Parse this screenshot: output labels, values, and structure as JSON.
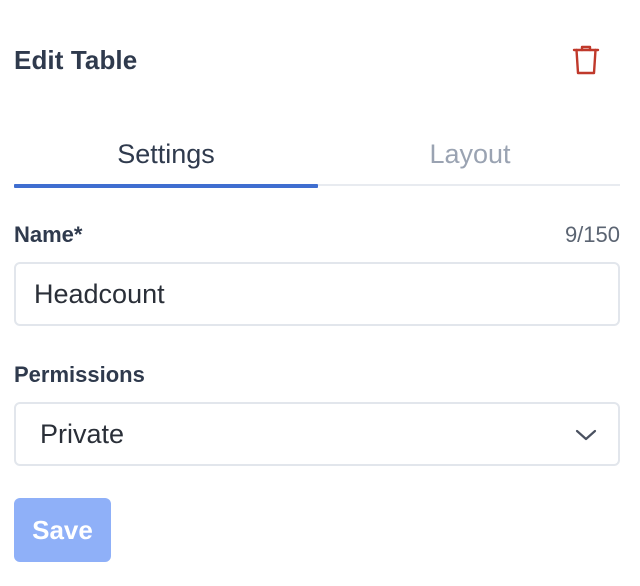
{
  "header": {
    "title": "Edit Table",
    "delete_icon": "trash-icon",
    "delete_color": "#c0392b"
  },
  "tabs": [
    {
      "label": "Settings",
      "active": true
    },
    {
      "label": "Layout",
      "active": false
    }
  ],
  "name_field": {
    "label": "Name*",
    "value": "Headcount",
    "counter": "9/150"
  },
  "permissions_field": {
    "label": "Permissions",
    "value": "Private",
    "icon": "chevron-down-icon"
  },
  "save_button": {
    "label": "Save",
    "color": "#8fb0f8"
  },
  "colors": {
    "accent": "#3f6ed0"
  }
}
